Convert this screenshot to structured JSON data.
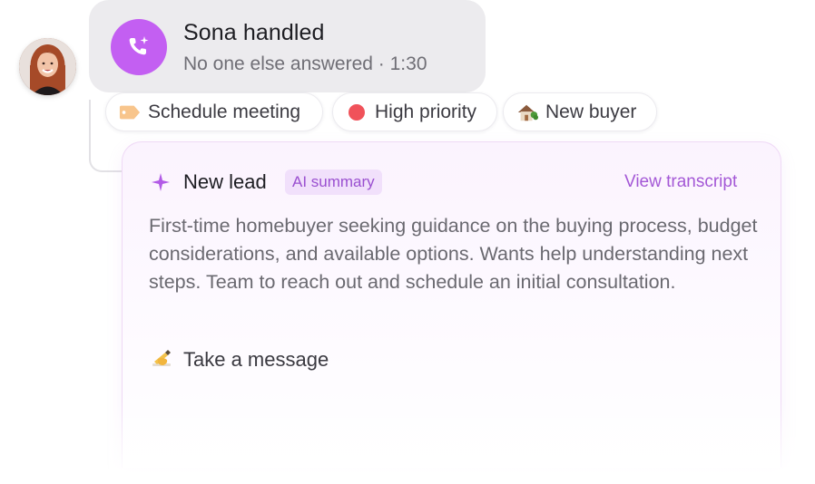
{
  "call": {
    "title": "Sona handled",
    "subtitle": "No one else answered · 1:30",
    "icon": "phone-sparkle-icon",
    "icon_color": "#c35ff2"
  },
  "tags": [
    {
      "label": "Schedule meeting",
      "icon": "label-tag-icon"
    },
    {
      "label": "High priority",
      "icon": "red-dot-icon",
      "color": "#f0525a"
    },
    {
      "label": "New buyer",
      "icon": "house-icon"
    }
  ],
  "card": {
    "title": "New lead",
    "badge": "AI summary",
    "link": "View transcript",
    "summary": "First-time homebuyer seeking guidance on the buying process, budget considerations, and available options. Wants help understanding next steps. Team to reach out and schedule an initial consultation.",
    "action": "Take a message",
    "action_icon": "writing-hand-icon",
    "accent": "#a458d6"
  }
}
